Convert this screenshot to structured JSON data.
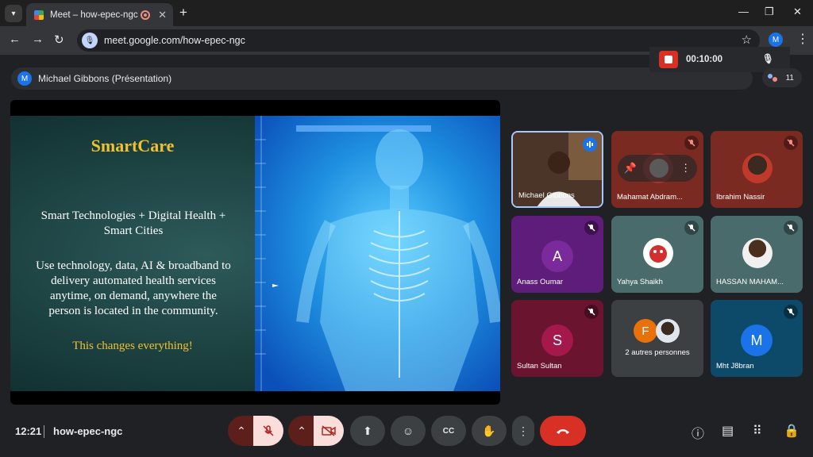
{
  "browser": {
    "tab_title": "Meet – how-epec-ngc",
    "url": "meet.google.com/how-epec-ngc",
    "profile_initial": "M"
  },
  "meet": {
    "presenter_label": "Michael Gibbons (Présentation)",
    "presenter_initial": "M",
    "recording_time": "00:10:00",
    "participant_count": "11",
    "clock": "12:21",
    "meeting_code": "how-epec-ngc"
  },
  "slide": {
    "title": "SmartCare",
    "subtitle": "Smart Technologies + Digital Health + Smart Cities",
    "body": "Use technology, data, AI & broadband to delivery automated health services anytime, on demand, anywhere the person is located in the community.",
    "footer": "This changes everything!"
  },
  "tiles": [
    {
      "name": "Michael Gibbons",
      "kind": "video",
      "speaking": true
    },
    {
      "name": "Mahamat Abdram...",
      "kind": "photo",
      "muted": true,
      "bg": "#7b2a22"
    },
    {
      "name": "Ibrahim Nassir",
      "kind": "photo",
      "muted": true,
      "bg": "#7b2a22"
    },
    {
      "name": "Anass Oumar",
      "kind": "letter",
      "letter": "A",
      "muted": true,
      "bg": "#5e1d7a",
      "circle": "#7b2a9b"
    },
    {
      "name": "Yahya Shaikh",
      "kind": "photo",
      "muted": true,
      "bg": "#4a6b6b"
    },
    {
      "name": "HASSAN MAHAM...",
      "kind": "photo",
      "muted": true,
      "bg": "#4a6b6b"
    },
    {
      "name": "Sultan Sultan",
      "kind": "letter",
      "letter": "S",
      "muted": true,
      "bg": "#6b1430",
      "circle": "#a4184b"
    },
    {
      "name": "2 autres personnes",
      "kind": "group",
      "letter": "F",
      "bg": "#3c4043"
    },
    {
      "name": "Mht J8bran",
      "kind": "letter",
      "letter": "M",
      "muted": true,
      "bg": "#0d4a6a",
      "circle": "#1a73e8"
    }
  ]
}
